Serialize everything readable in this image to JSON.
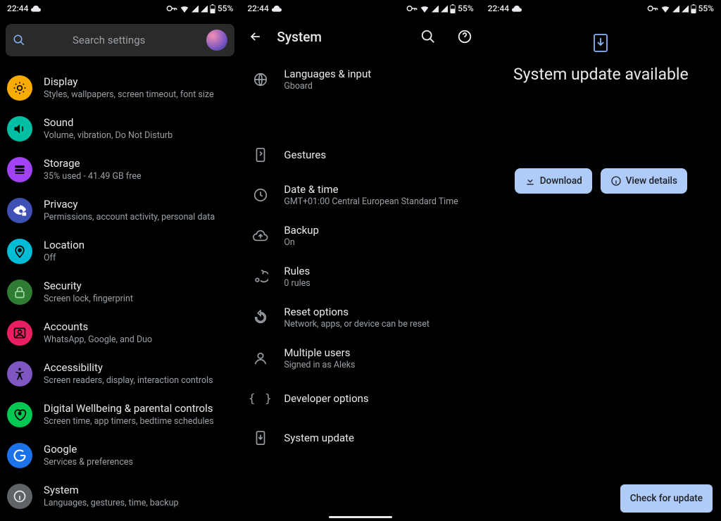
{
  "status": {
    "time": "22:44",
    "battery": "55%"
  },
  "pane1": {
    "search_placeholder": "Search settings",
    "items": [
      {
        "title": "Display",
        "sub": "Styles, wallpapers, screen timeout, font size"
      },
      {
        "title": "Sound",
        "sub": "Volume, vibration, Do Not Disturb"
      },
      {
        "title": "Storage",
        "sub": "35% used - 41.49 GB free"
      },
      {
        "title": "Privacy",
        "sub": "Permissions, account activity, personal data"
      },
      {
        "title": "Location",
        "sub": "Off"
      },
      {
        "title": "Security",
        "sub": "Screen lock, fingerprint"
      },
      {
        "title": "Accounts",
        "sub": "WhatsApp, Google, and Duo"
      },
      {
        "title": "Accessibility",
        "sub": "Screen readers, display, interaction controls"
      },
      {
        "title": "Digital Wellbeing & parental controls",
        "sub": "Screen time, app timers, bedtime schedules"
      },
      {
        "title": "Google",
        "sub": "Services & preferences"
      },
      {
        "title": "System",
        "sub": "Languages, gestures, time, backup"
      }
    ]
  },
  "pane2": {
    "header": "System",
    "items": [
      {
        "title": "Languages & input",
        "sub": "Gboard"
      },
      {
        "title": "Gestures",
        "sub": ""
      },
      {
        "title": "Date & time",
        "sub": "GMT+01:00 Central European Standard Time"
      },
      {
        "title": "Backup",
        "sub": "On"
      },
      {
        "title": "Rules",
        "sub": "0 rules"
      },
      {
        "title": "Reset options",
        "sub": "Network, apps, or device can be reset"
      },
      {
        "title": "Multiple users",
        "sub": "Signed in as Aleks"
      },
      {
        "title": "Developer options",
        "sub": ""
      },
      {
        "title": "System update",
        "sub": ""
      }
    ]
  },
  "pane3": {
    "title": "System update available",
    "download": "Download",
    "view_details": "View details",
    "check": "Check for update"
  }
}
